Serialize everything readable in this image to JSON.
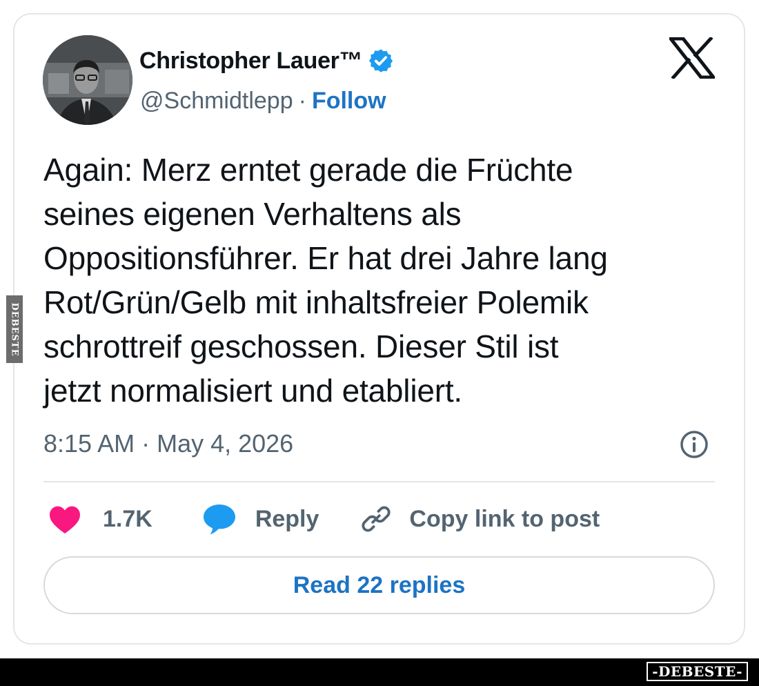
{
  "author": {
    "name": "Christopher Lauer™",
    "handle": "@Schmidtlepp",
    "separator": "·",
    "follow_label": "Follow",
    "verified": true,
    "avatar_icon": "profile-photo"
  },
  "platform_logo": "x-logo",
  "tweet": {
    "lines": [
      "Again: Merz erntet gerade die Früchte",
      "seines eigenen Verhaltens als",
      "Oppositionsführer. Er hat drei Jahre lang",
      "Rot/Grün/Gelb mit inhaltsfreier Polemik",
      "schrottreif geschossen. Dieser Stil ist",
      "jetzt normalisiert und etabliert."
    ],
    "timestamp": "8:15 AM · May 4, 2026"
  },
  "actions": {
    "like_count": "1.7K",
    "reply_label": "Reply",
    "copy_label": "Copy link to post"
  },
  "read_replies_label": "Read 22 replies",
  "watermarks": {
    "side": "DEBESTE",
    "bottom": "-DEBESTE-"
  },
  "colors": {
    "accent_blue": "#1d73c4",
    "verified_blue": "#1d9bf0",
    "like_pink": "#f91880",
    "reply_blue": "#1d9bf0",
    "muted_text": "#536471",
    "border": "#e3e6e8"
  }
}
